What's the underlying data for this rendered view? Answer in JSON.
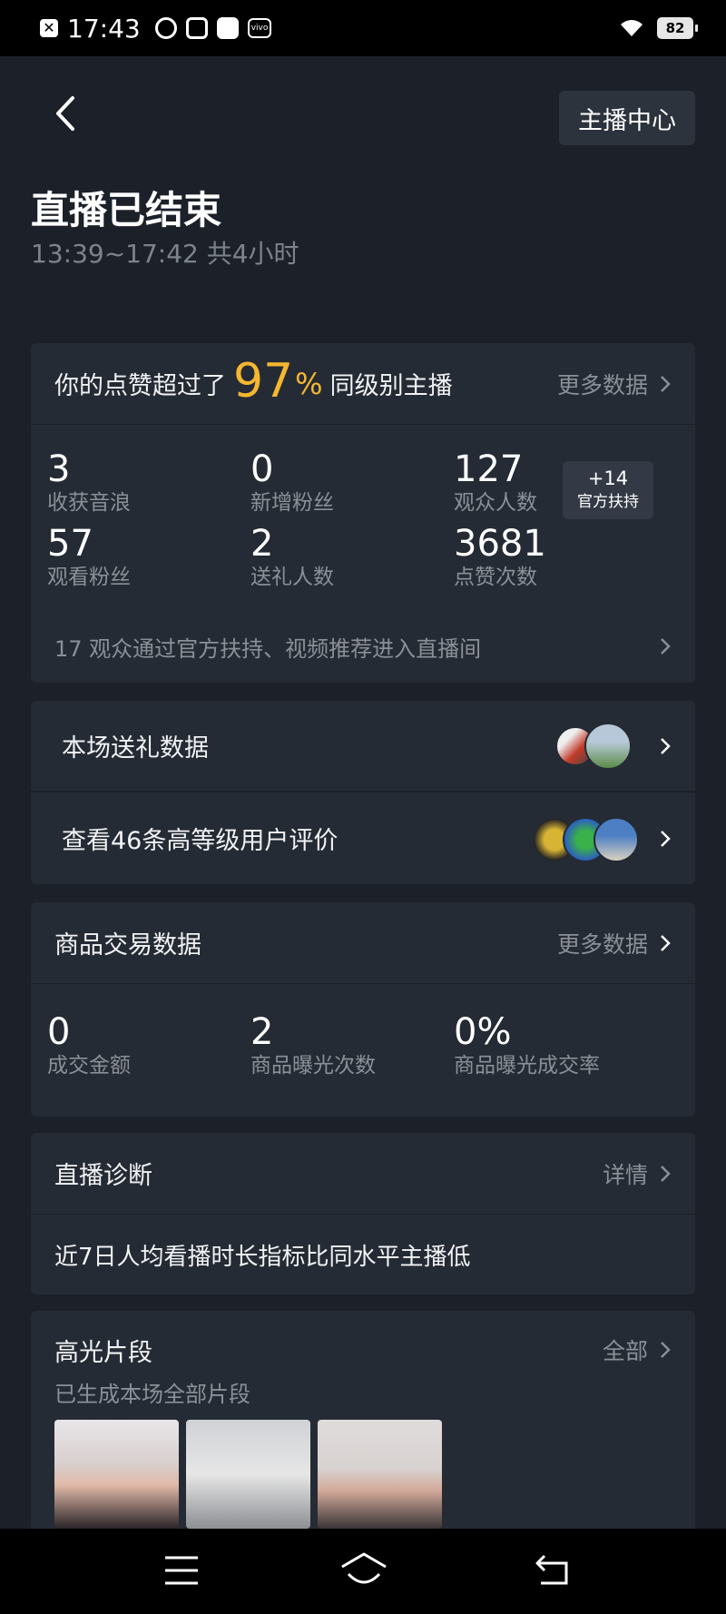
{
  "status_bar": {
    "time": "17:43",
    "battery": "82"
  },
  "header": {
    "anchor_center_label": "主播中心",
    "title": "直播已结束",
    "subtitle": "13:39~17:42 共4小时"
  },
  "likes_card": {
    "prefix": "你的点赞超过了",
    "percent": "97",
    "percent_sign": "%",
    "suffix": "同级别主播",
    "more": "更多数据",
    "stats": [
      {
        "value": "3",
        "label": "收获音浪"
      },
      {
        "value": "0",
        "label": "新增粉丝"
      },
      {
        "value": "127",
        "label": "观众人数"
      },
      {
        "value": "57",
        "label": "观看粉丝"
      },
      {
        "value": "2",
        "label": "送礼人数"
      },
      {
        "value": "3681",
        "label": "点赞次数"
      }
    ],
    "support_pill": {
      "count": "+14",
      "label": "官方扶持"
    },
    "footer": "17 观众通过官方扶持、视频推荐进入直播间"
  },
  "gift_card": {
    "gift_data": "本场送礼数据",
    "reviews": "查看46条高等级用户评价"
  },
  "trade_card": {
    "title": "商品交易数据",
    "more": "更多数据",
    "stats": [
      {
        "value": "0",
        "label": "成交金额"
      },
      {
        "value": "2",
        "label": "商品曝光次数"
      },
      {
        "value": "0%",
        "label": "商品曝光成交率"
      }
    ]
  },
  "diagnosis_card": {
    "title": "直播诊断",
    "more": "详情",
    "text": "近7日人均看播时长指标比同水平主播低"
  },
  "highlight_card": {
    "title": "高光片段",
    "more": "全部",
    "subtitle": "已生成本场全部片段"
  },
  "colors": {
    "accent": "#f5b730",
    "background": "#1b2029",
    "card": "#252b34"
  }
}
